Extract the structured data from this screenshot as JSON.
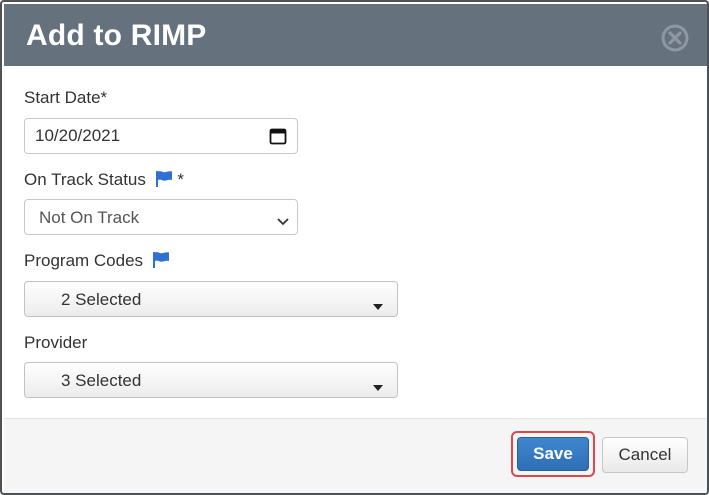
{
  "dialog": {
    "title": "Add to RIMP",
    "close_icon": "close-circle-icon"
  },
  "form": {
    "start_date": {
      "label": "Start Date*",
      "value": "10/20/2021",
      "icon": "calendar-icon"
    },
    "on_track_status": {
      "label": "On Track Status",
      "required_mark": "*",
      "flag_icon": "flag-icon",
      "value": "Not On Track"
    },
    "program_codes": {
      "label": "Program Codes",
      "flag_icon": "flag-icon",
      "value": "2 Selected"
    },
    "provider": {
      "label": "Provider",
      "value": "3 Selected"
    }
  },
  "footer": {
    "save_label": "Save",
    "cancel_label": "Cancel"
  },
  "colors": {
    "header_bg": "#66717e",
    "flag_blue": "#2f6fd6",
    "save_bg": "#337ab7",
    "highlight": "#e0474c"
  }
}
